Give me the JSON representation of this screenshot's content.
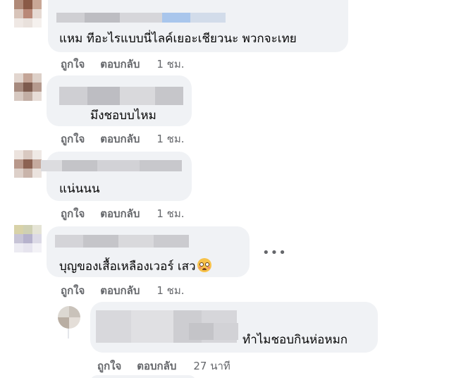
{
  "actions": {
    "like": "ถูกใจ",
    "reply": "ตอบกลับ"
  },
  "comments": [
    {
      "text": "แหม ทีอะไรแบบนี่ไลค์เยอะเชียวนะ พวกจะเทย",
      "time": "1 ชม."
    },
    {
      "text": "มึงชอบบไหม",
      "time": "1 ชม."
    },
    {
      "text": "แน่นนน",
      "time": "1 ชม."
    },
    {
      "text": "บุญของเสื้อเหลืองเวอร์ เสว",
      "emoji": "pleading-face-icon",
      "time": "1 ชม."
    },
    {
      "text": "ทำไมชอบกินห่อหมก",
      "time": "27 นาที"
    }
  ],
  "more_label": "•••",
  "colors": {
    "bubble": "#f0f2f5",
    "meta_text": "#65676b",
    "body_text": "#050505"
  }
}
